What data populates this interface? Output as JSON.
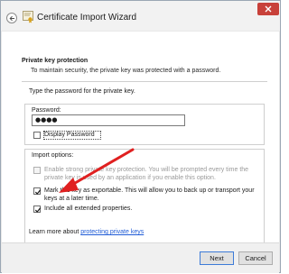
{
  "window": {
    "title": "Certificate Import Wizard"
  },
  "header": {
    "title": "Private key protection",
    "description": "To maintain security, the private key was protected with a password."
  },
  "password_section": {
    "instruction": "Type the password for the private key.",
    "label": "Password:",
    "value": "●●●●",
    "display_password_label": "Display Password",
    "display_password_checked": false
  },
  "import_options": {
    "label": "Import options:",
    "options": [
      {
        "line1": "Enable strong private key protection. You will be prompted every time the",
        "line2": "private key is used by an application if you enable this option.",
        "checked": false,
        "enabled": false
      },
      {
        "line1": "Mark this key as exportable. This will allow you to back up or transport your",
        "line2": "keys at a later time.",
        "checked": true,
        "enabled": true
      },
      {
        "line1": "Include all extended properties.",
        "line2": "",
        "checked": true,
        "enabled": true
      }
    ]
  },
  "learn_more": {
    "prefix": "Learn more about ",
    "link": "protecting private keys"
  },
  "footer": {
    "next_label": "Next",
    "cancel_label": "Cancel"
  },
  "annotation": {
    "arrow_color": "#e02020"
  },
  "colors": {
    "close_button": "#c8413a",
    "link": "#1f5bd6",
    "primary_button_border": "#3d7bd8"
  }
}
